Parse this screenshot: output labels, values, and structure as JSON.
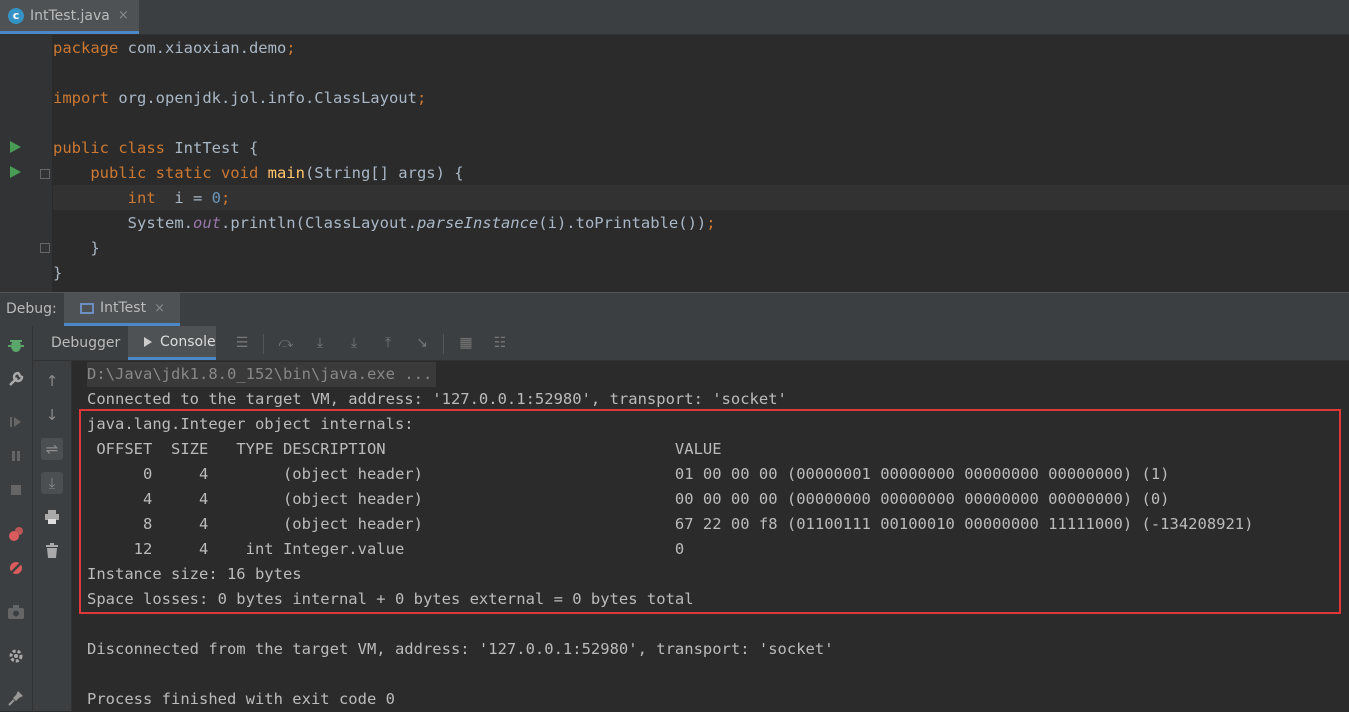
{
  "editor_tab": {
    "filename": "IntTest.java",
    "close": "×"
  },
  "code_lines": [
    {
      "tokens": [
        {
          "t": "package ",
          "c": "kw"
        },
        {
          "t": "com.xiaoxian.demo",
          "c": "plain"
        },
        {
          "t": ";",
          "c": "kw"
        }
      ]
    },
    {
      "tokens": []
    },
    {
      "tokens": [
        {
          "t": "import ",
          "c": "kw"
        },
        {
          "t": "org.openjdk.jol.info.ClassLayout",
          "c": "plain"
        },
        {
          "t": ";",
          "c": "kw"
        }
      ]
    },
    {
      "tokens": []
    },
    {
      "tokens": [
        {
          "t": "public class ",
          "c": "kw"
        },
        {
          "t": "IntTest {",
          "c": "plain"
        }
      ]
    },
    {
      "tokens": [
        {
          "t": "    public static void ",
          "c": "kw"
        },
        {
          "t": "main",
          "c": "fn"
        },
        {
          "t": "(String[] args) {",
          "c": "plain"
        }
      ]
    },
    {
      "tokens": [
        {
          "t": "        int ",
          "c": "kw"
        },
        {
          "t": " i = ",
          "c": "plain"
        },
        {
          "t": "0",
          "c": "num"
        },
        {
          "t": ";",
          "c": "kw"
        }
      ]
    },
    {
      "tokens": [
        {
          "t": "        System.",
          "c": "plain"
        },
        {
          "t": "out",
          "c": "field"
        },
        {
          "t": ".println(ClassLayout.",
          "c": "plain"
        },
        {
          "t": "parseInstance",
          "c": "italic"
        },
        {
          "t": "(i).toPrintable())",
          "c": "plain"
        },
        {
          "t": ";",
          "c": "kw"
        }
      ]
    },
    {
      "tokens": [
        {
          "t": "    }",
          "c": "plain"
        }
      ]
    },
    {
      "tokens": [
        {
          "t": "}",
          "c": "plain"
        }
      ]
    }
  ],
  "debug_panel": {
    "label": "Debug:",
    "tab_name": "IntTest",
    "tab_close": "×",
    "subtab_debugger": "Debugger",
    "subtab_console": "Console"
  },
  "console_lines": [
    "D:\\Java\\jdk1.8.0_152\\bin\\java.exe ...",
    "Connected to the target VM, address: '127.0.0.1:52980', transport: 'socket'",
    "java.lang.Integer object internals:",
    " OFFSET  SIZE   TYPE DESCRIPTION                               VALUE",
    "      0     4        (object header)                           01 00 00 00 (00000001 00000000 00000000 00000000) (1)",
    "      4     4        (object header)                           00 00 00 00 (00000000 00000000 00000000 00000000) (0)",
    "      8     4        (object header)                           67 22 00 f8 (01100111 00100010 00000000 11111000) (-134208921)",
    "     12     4    int Integer.value                             0",
    "Instance size: 16 bytes",
    "Space losses: 0 bytes internal + 0 bytes external = 0 bytes total",
    "",
    "Disconnected from the target VM, address: '127.0.0.1:52980', transport: 'socket'",
    "",
    "Process finished with exit code 0"
  ],
  "colors": {
    "keyword": "#cc7832",
    "number": "#6897bb",
    "method": "#ffc66d",
    "field": "#9876aa",
    "highlight_border": "#e0373b",
    "tab_underline": "#4a88c7"
  }
}
